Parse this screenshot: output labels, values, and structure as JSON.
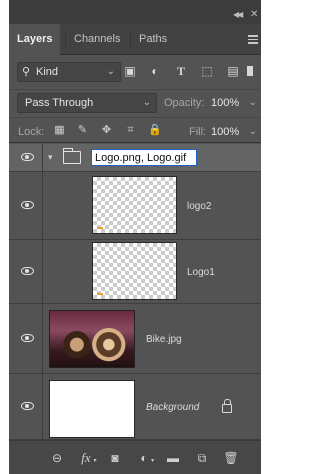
{
  "panel": {
    "tabs": [
      {
        "label": "Layers",
        "active": true
      },
      {
        "label": "Channels",
        "active": false
      },
      {
        "label": "Paths",
        "active": false
      }
    ],
    "collapse_icon": "double-chevron-right-icon",
    "close_icon": "close-icon",
    "menu_icon": "hamburger-menu-icon"
  },
  "filter": {
    "kind_label": "Kind",
    "icons": [
      "pixel-filter-icon",
      "adjustment-filter-icon",
      "type-filter-icon",
      "shape-filter-icon",
      "smart-object-filter-icon"
    ]
  },
  "blend": {
    "mode": "Pass Through",
    "opacity_label": "Opacity:",
    "opacity_value": "100%"
  },
  "lock": {
    "label": "Lock:",
    "icons": [
      "lock-transparent-pixels-icon",
      "lock-image-pixels-icon",
      "lock-position-icon",
      "lock-artboard-icon",
      "lock-all-icon"
    ],
    "fill_label": "Fill:",
    "fill_value": "100%"
  },
  "layers": [
    {
      "name": "Logo.png, Logo.gif",
      "type": "group",
      "visible": true,
      "editing": true
    },
    {
      "name": "logo2",
      "type": "layer",
      "visible": true
    },
    {
      "name": "Logo1",
      "type": "layer",
      "visible": true
    },
    {
      "name": "Bike.jpg",
      "type": "image",
      "visible": true
    },
    {
      "name": "Background",
      "type": "background",
      "visible": true,
      "locked": true
    }
  ],
  "bottom_icons": [
    "link-layers-icon",
    "fx-icon",
    "mask-icon",
    "adjustment-layer-icon",
    "new-group-icon",
    "new-layer-icon",
    "delete-icon"
  ],
  "labels": {
    "fx": "fx"
  }
}
